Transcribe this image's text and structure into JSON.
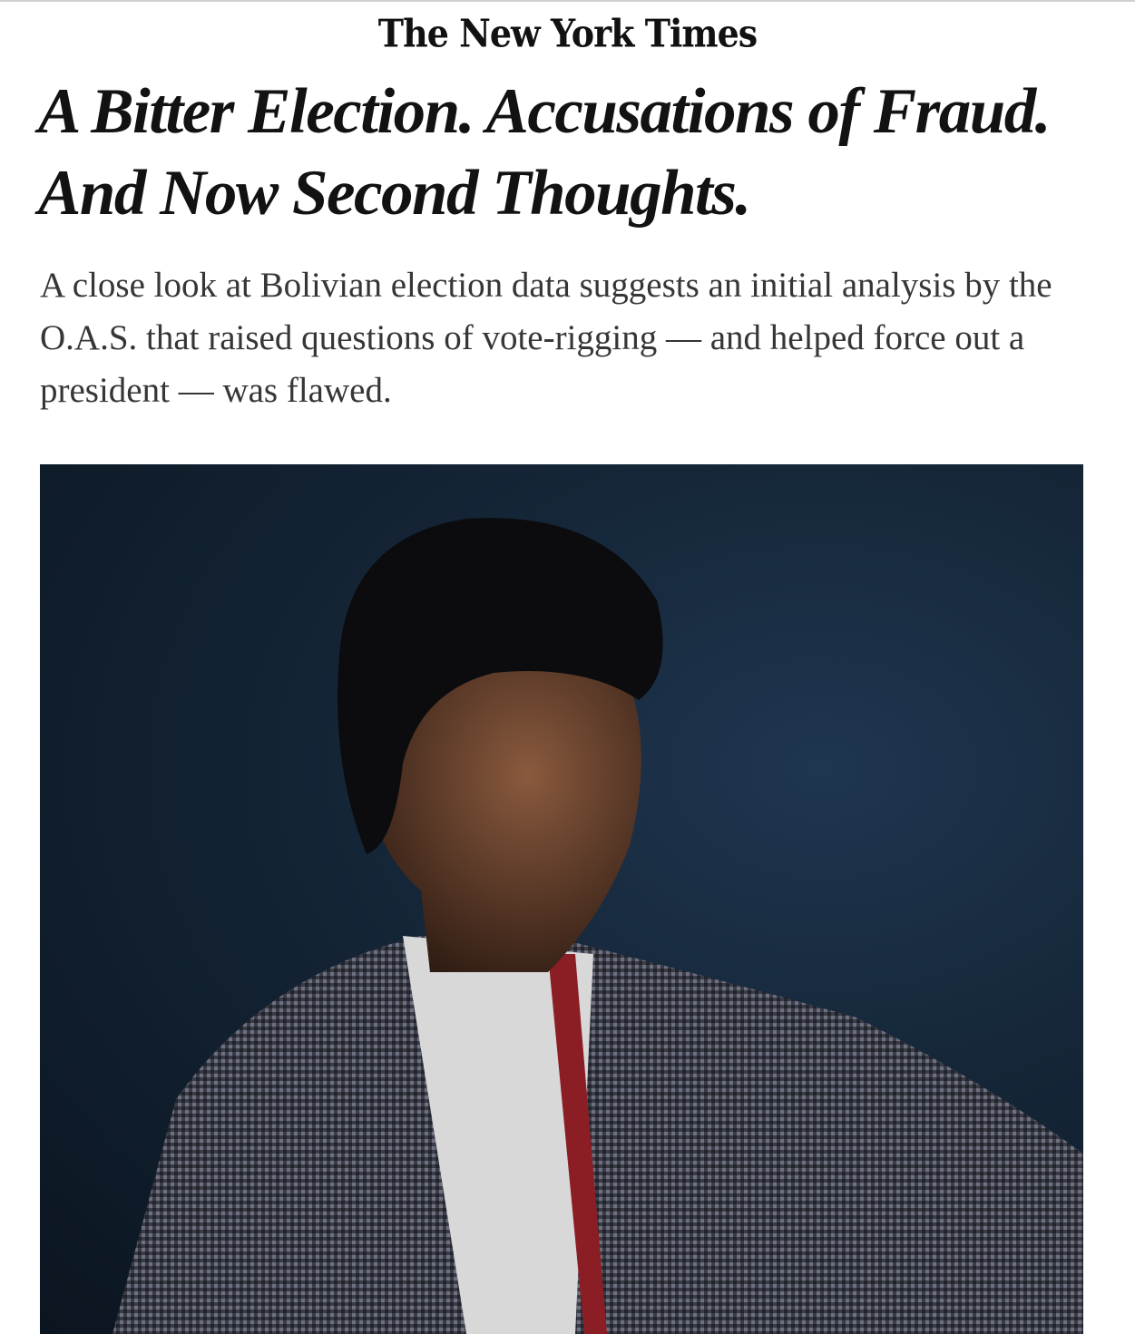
{
  "masthead": {
    "logo_text": "The New York Times"
  },
  "article": {
    "headline": "A Bitter Election. Accusations of Fraud. And Now Second Thoughts.",
    "summary": "A close look at Bolivian election data suggests an initial analysis by the O.A.S. that raised questions of vote-rigging — and helped force out a president — was flawed."
  }
}
